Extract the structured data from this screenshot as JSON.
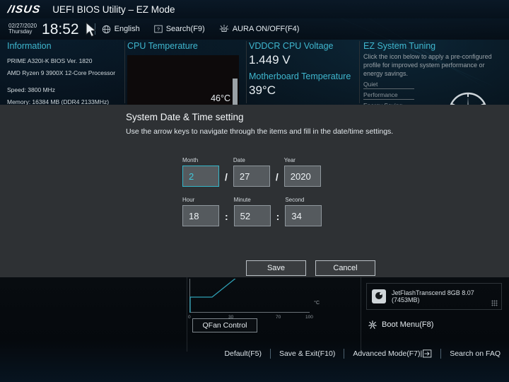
{
  "titlebar": {
    "brand": "/ISUS",
    "title": "UEFI BIOS Utility – EZ Mode"
  },
  "infobar": {
    "date": "02/27/2020",
    "weekday": "Thursday",
    "time": "18:52",
    "language": "English",
    "search": "Search(F9)",
    "aura": "AURA ON/OFF(F4)"
  },
  "information": {
    "heading": "Information",
    "board": "PRIME A320I-K    BIOS Ver. 1820",
    "cpu": "AMD Ryzen 9 3900X 12-Core Processor",
    "speed": "Speed: 3800 MHz",
    "memory": "Memory: 16384 MB (DDR4 2133MHz)"
  },
  "cpu_temp": {
    "heading": "CPU Temperature",
    "value": "46°C"
  },
  "voltage": {
    "heading": "VDDCR CPU Voltage",
    "value": "1.449 V",
    "mb_heading": "Motherboard Temperature",
    "mb_value": "39°C"
  },
  "ez_tuning": {
    "heading": "EZ System Tuning",
    "description": "Click the icon below to apply a pre-configured profile for improved system performance or energy savings.",
    "options": [
      "Quiet",
      "Performance",
      "Energy Saving"
    ]
  },
  "fan": {
    "ticks": [
      "0",
      "30",
      "70",
      "100"
    ],
    "unit": "°C",
    "qfan_button": "QFan Control"
  },
  "boot": {
    "device": "JetFlashTranscend 8GB 8.07  (7453MB)",
    "menu_label": "Boot Menu(F8)"
  },
  "footer": {
    "items": [
      "Default(F5)",
      "Save & Exit(F10)",
      "Advanced Mode(F7)|",
      "Search on FAQ"
    ]
  },
  "modal": {
    "title": "System Date & Time setting",
    "subtitle": "Use the arrow keys to navigate through the items and fill in the date/time settings.",
    "date_row": [
      {
        "label": "Month",
        "value": "2",
        "focused": true
      },
      {
        "label": "Date",
        "value": "27",
        "focused": false
      },
      {
        "label": "Year",
        "value": "2020",
        "focused": false
      }
    ],
    "date_sep": "/",
    "time_row": [
      {
        "label": "Hour",
        "value": "18",
        "focused": false
      },
      {
        "label": "Minute",
        "value": "52",
        "focused": false
      },
      {
        "label": "Second",
        "value": "34",
        "focused": false
      }
    ],
    "time_sep": ":",
    "save_label": "Save",
    "cancel_label": "Cancel"
  },
  "colors": {
    "accent": "#3fb7cf",
    "focus": "#35b6c9",
    "modal_bg": "#2e3134"
  }
}
